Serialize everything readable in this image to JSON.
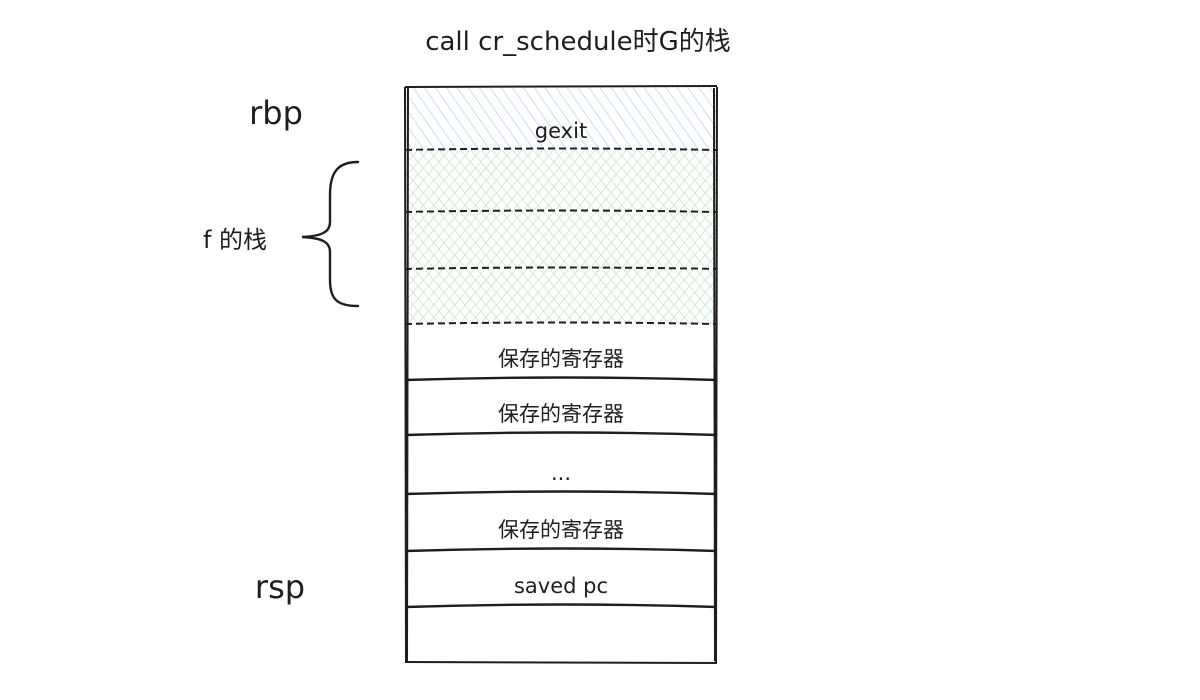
{
  "title": "call cr_schedule时G的栈",
  "labels": {
    "rbp": "rbp",
    "rsp": "rsp",
    "f_stack": "f 的栈"
  },
  "stack": {
    "cells": [
      {
        "text": "gexit",
        "fill": "hatch-blue"
      },
      {
        "text": "",
        "fill": "hatch-green"
      },
      {
        "text": "",
        "fill": "hatch-green"
      },
      {
        "text": "",
        "fill": "hatch-green"
      },
      {
        "text": "保存的寄存器",
        "fill": "none"
      },
      {
        "text": "保存的寄存器",
        "fill": "none"
      },
      {
        "text": "...",
        "fill": "none"
      },
      {
        "text": "保存的寄存器",
        "fill": "none"
      },
      {
        "text": "saved pc",
        "fill": "none"
      },
      {
        "text": "",
        "fill": "none"
      }
    ]
  },
  "colors": {
    "stroke": "#1e1e1e",
    "hatch_blue": "#a5c0ec",
    "hatch_green": "#b2dcb0"
  }
}
